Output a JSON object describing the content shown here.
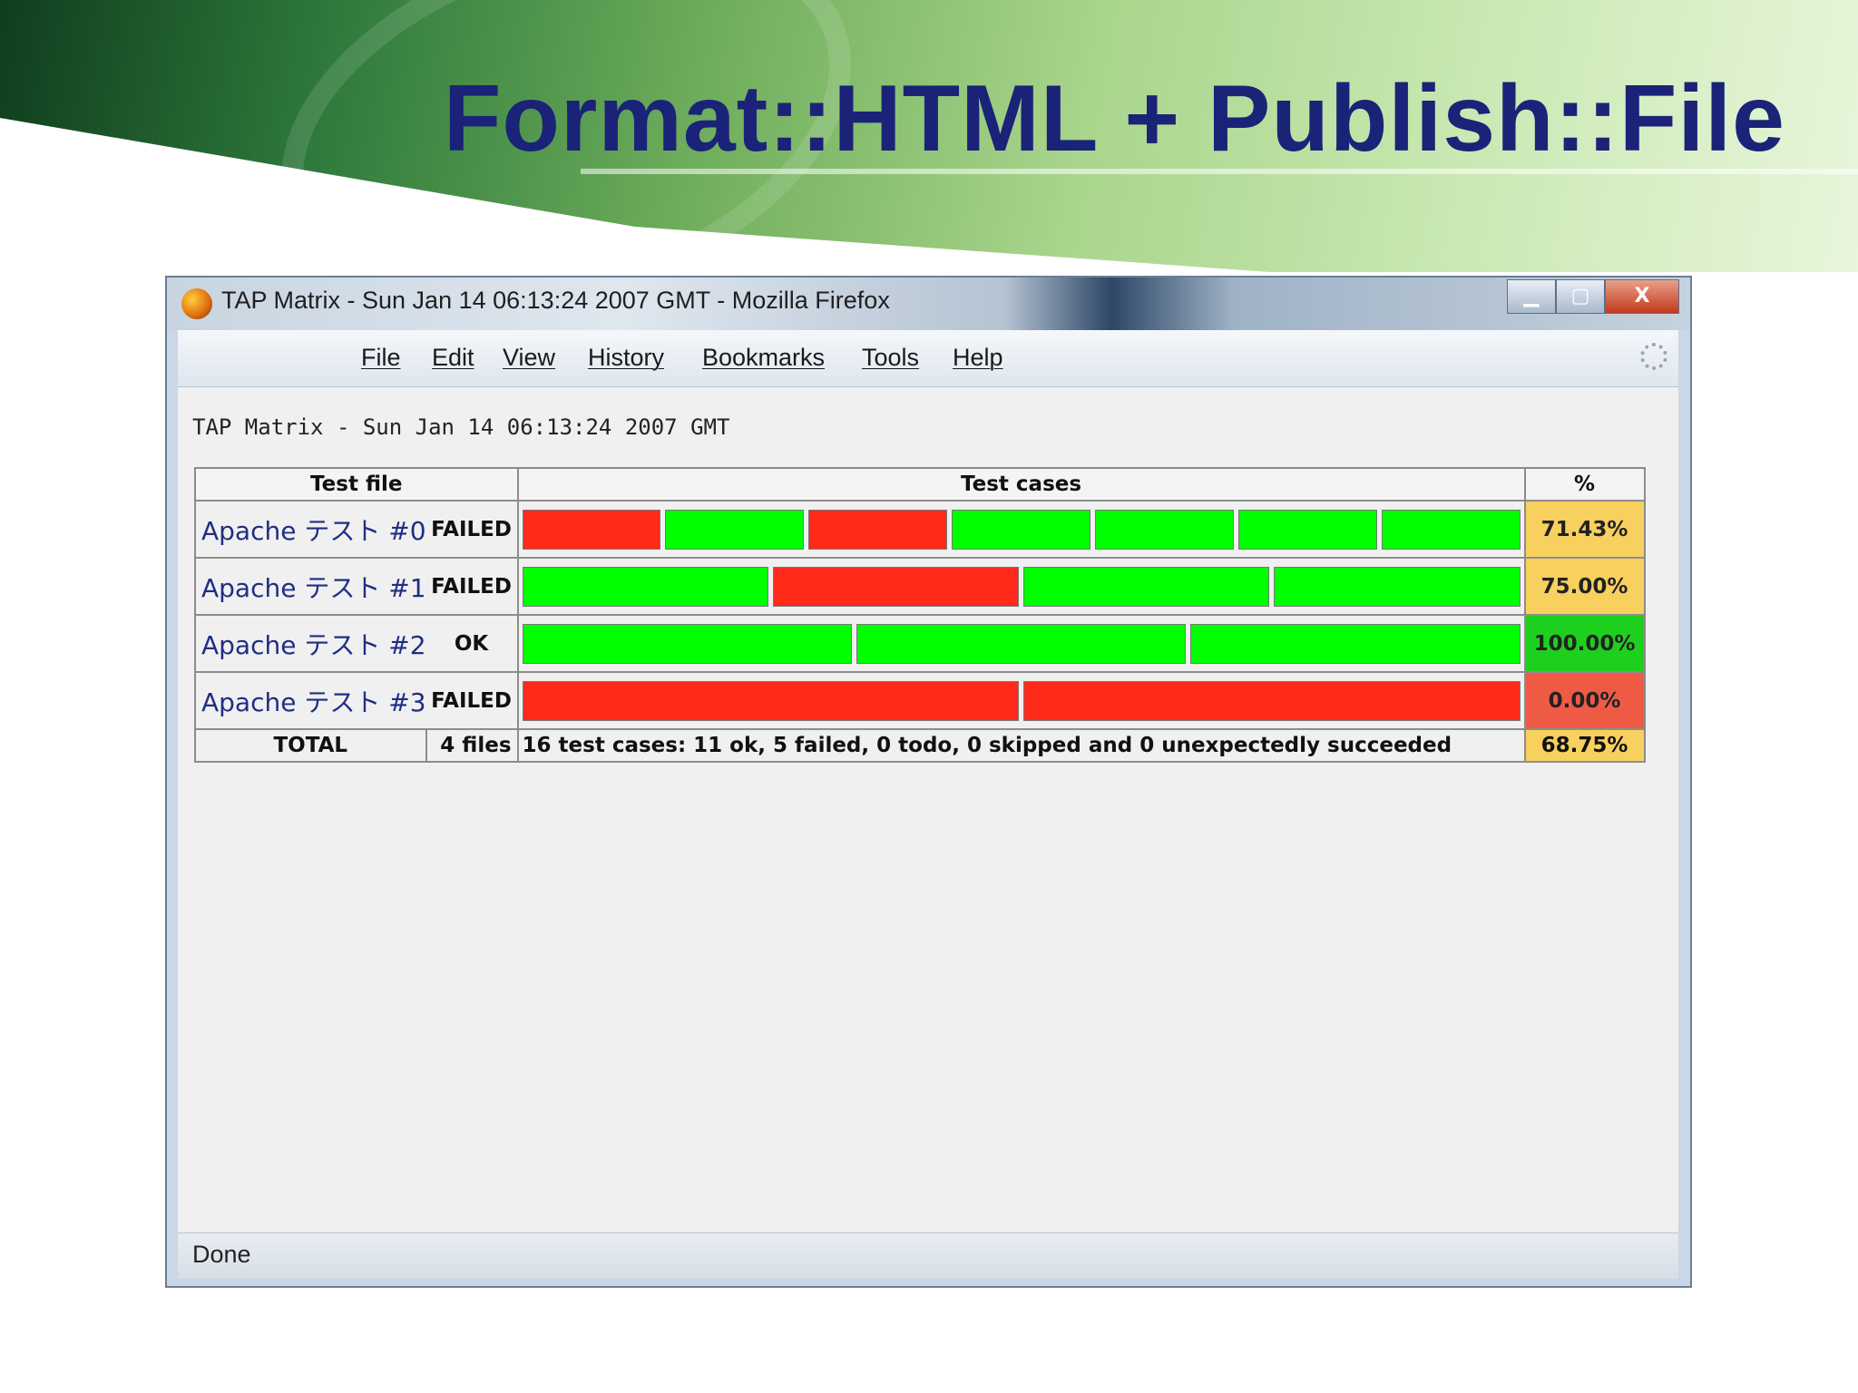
{
  "slide": {
    "title": "Format::HTML + Publish::File"
  },
  "window": {
    "title": "TAP Matrix - Sun Jan 14 06:13:24 2007 GMT - Mozilla Firefox",
    "buttons": {
      "minimize": "▁",
      "maximize": "▢",
      "close": "X"
    }
  },
  "menu": {
    "items": [
      "File",
      "Edit",
      "View",
      "History",
      "Bookmarks",
      "Tools",
      "Help"
    ]
  },
  "page": {
    "heading": "TAP Matrix - Sun Jan 14 06:13:24 2007 GMT",
    "table": {
      "headers": {
        "file": "Test file",
        "cases": "Test cases",
        "pct": "%"
      },
      "rows": [
        {
          "name": "Apache テスト #0",
          "status": "FAILED",
          "percent": "71.43%",
          "cases": [
            "fail",
            "ok",
            "fail",
            "ok",
            "ok",
            "ok",
            "ok"
          ],
          "pct_color": "#f7d05e"
        },
        {
          "name": "Apache テスト #1",
          "status": "FAILED",
          "percent": "75.00%",
          "cases": [
            "ok",
            "fail",
            "ok",
            "ok"
          ],
          "pct_color": "#f7d05e"
        },
        {
          "name": "Apache テスト #2",
          "status": "OK",
          "percent": "100.00%",
          "cases": [
            "ok",
            "ok",
            "ok"
          ],
          "pct_color": "#1ed01e"
        },
        {
          "name": "Apache テスト #3",
          "status": "FAILED",
          "percent": "0.00%",
          "cases": [
            "fail",
            "fail"
          ],
          "pct_color": "#ef5a45"
        }
      ],
      "total": {
        "label": "TOTAL",
        "files": "4 files",
        "summary": "16 test cases: 11 ok, 5 failed, 0 todo, 0 skipped and 0 unexpectedly succeeded",
        "percent": "68.75%",
        "pct_color": "#f7d05e"
      }
    }
  },
  "status": {
    "text": "Done"
  }
}
